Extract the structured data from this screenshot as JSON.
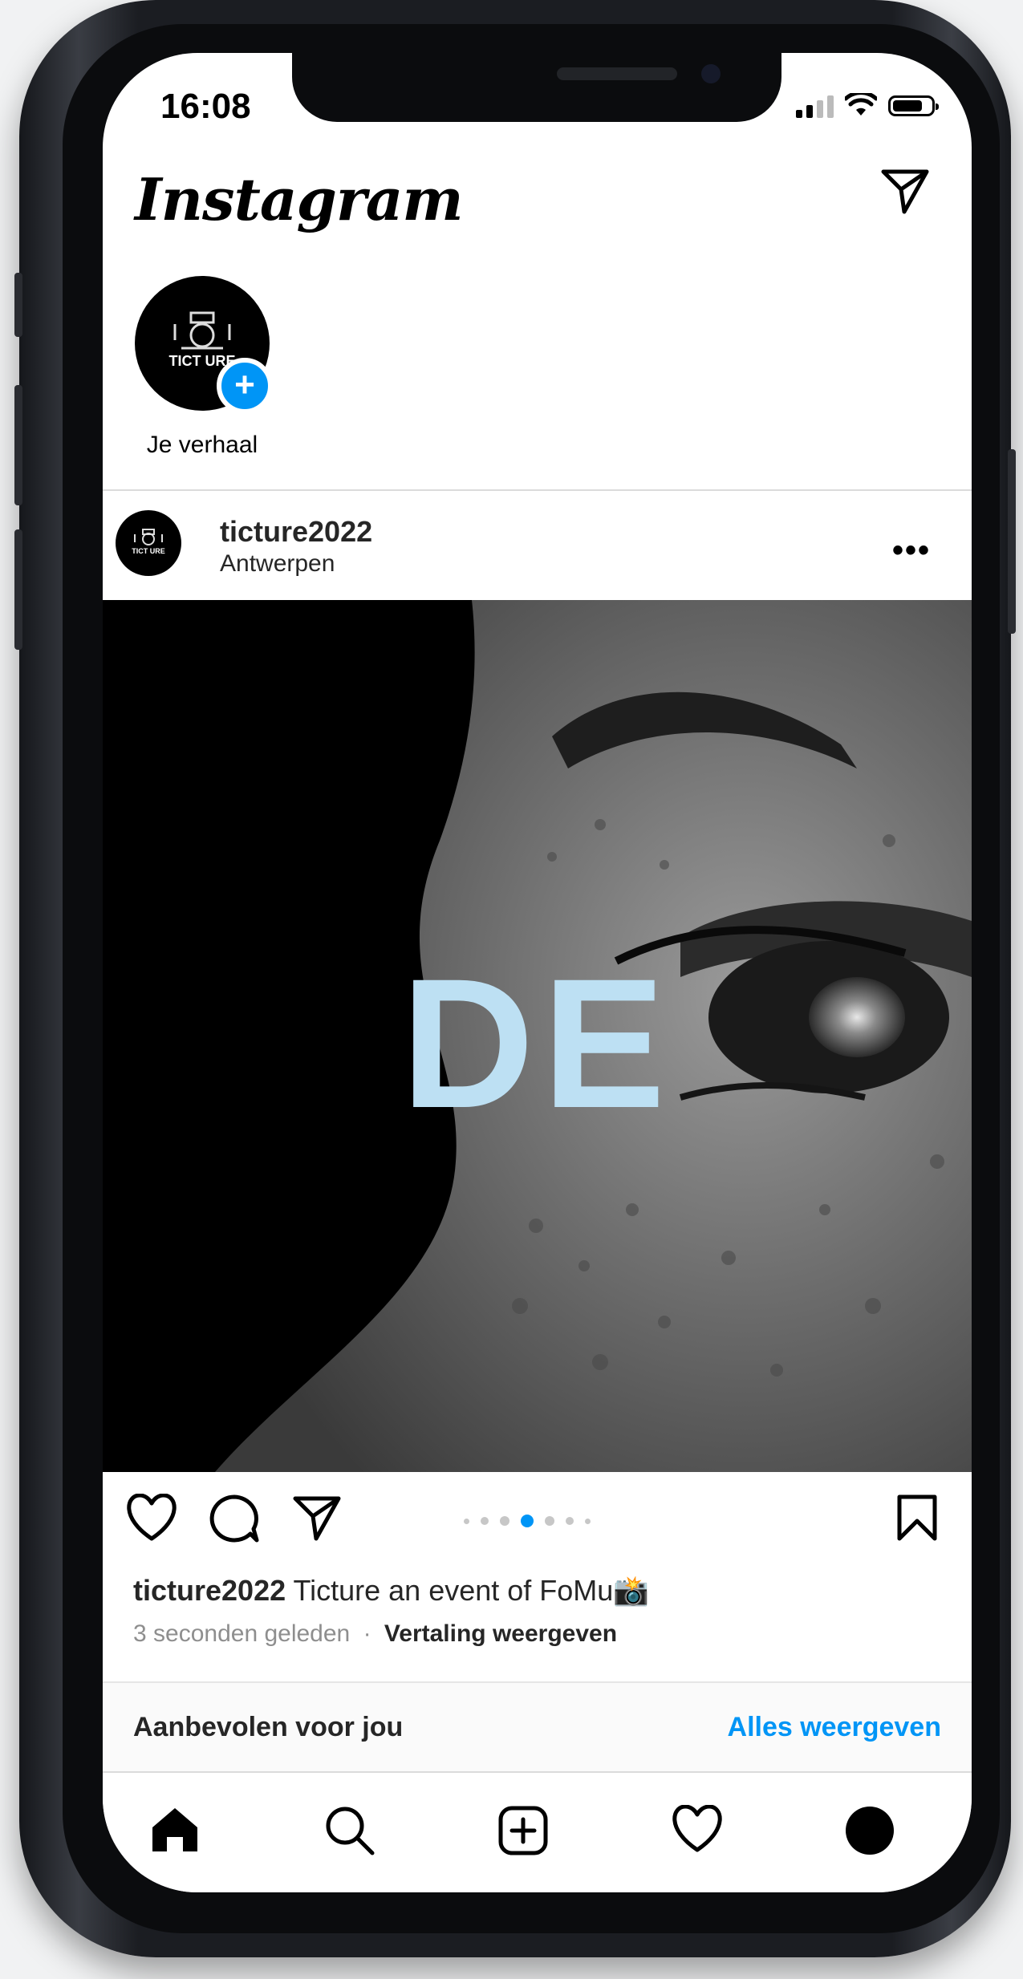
{
  "status_bar": {
    "time": "16:08"
  },
  "header": {
    "logo": "Instagram",
    "direct_icon": "send-icon"
  },
  "story": {
    "avatar_text": "TICT URE",
    "label": "Je verhaal"
  },
  "post": {
    "username": "ticture2022",
    "location": "Antwerpen",
    "overlay_text": "DE",
    "avatar_text": "TICT URE",
    "carousel": {
      "count": 7,
      "active_index": 4
    },
    "caption_user": "ticture2022",
    "caption_text": "Ticture an event of FoMu📸",
    "time_ago": "3 seconden geleden",
    "separator": "·",
    "translate": "Vertaling weergeven"
  },
  "suggestions": {
    "title": "Aanbevolen voor jou",
    "link": "Alles weergeven"
  },
  "tabbar": {
    "items": [
      "home-icon",
      "search-icon",
      "new-post-icon",
      "activity-icon",
      "profile-avatar"
    ]
  },
  "colors": {
    "accent": "#0095f6",
    "overlay_text": "#bde0f3"
  }
}
